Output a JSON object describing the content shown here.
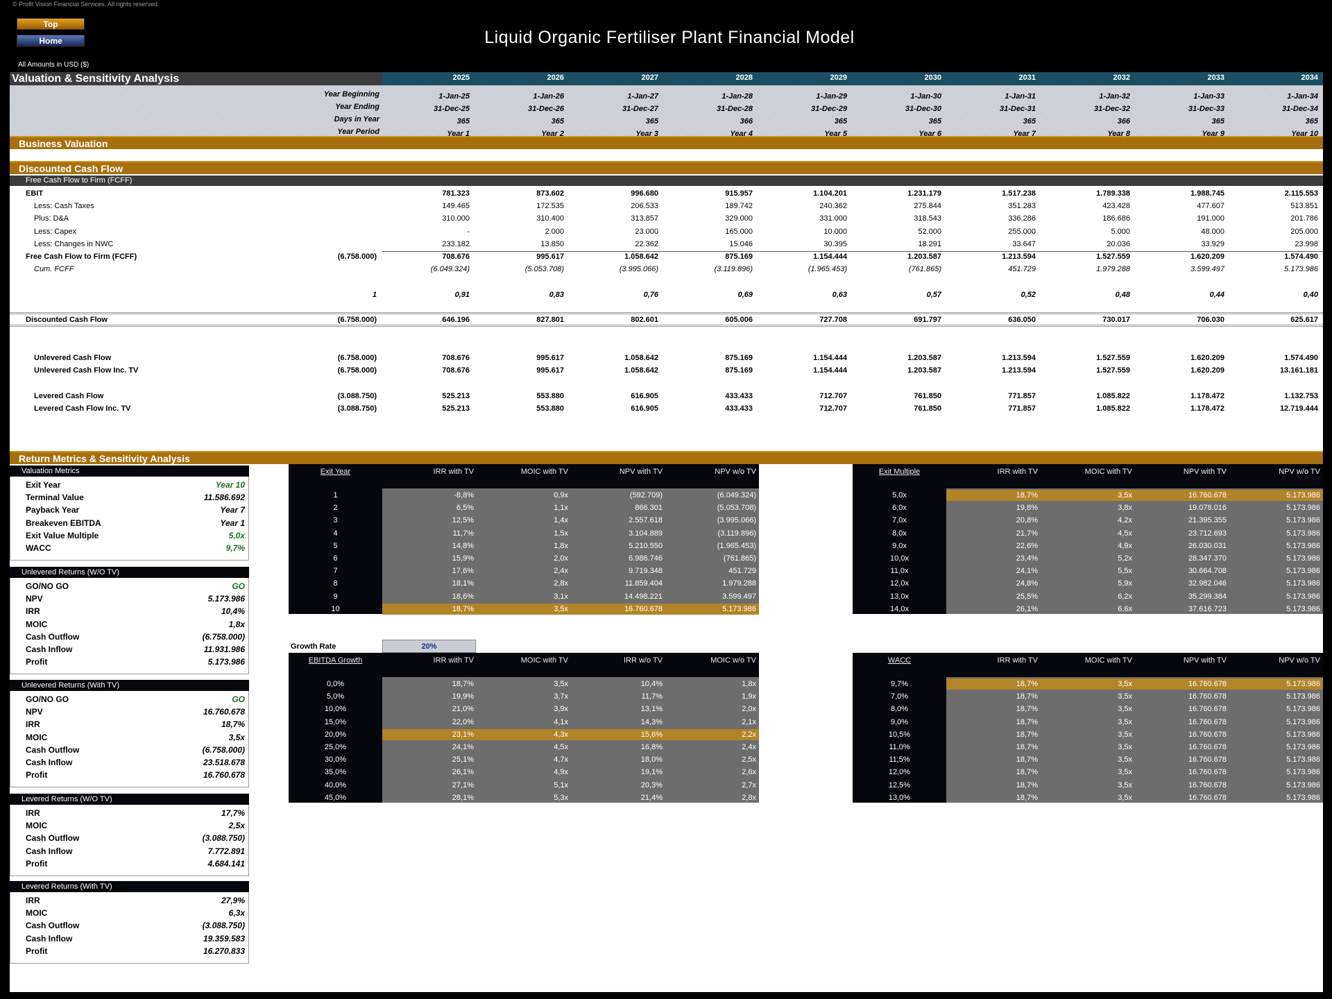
{
  "header": {
    "copyright": "© Profit Vision Financial Services. All rights reserved.",
    "top_button": "Top",
    "home_button": "Home",
    "title": "Liquid Organic Fertiliser Plant Financial Model",
    "currency_note": "All Amounts in  USD ($)"
  },
  "valuation": {
    "title": "Valuation & Sensitivity Analysis",
    "years": [
      "2025",
      "2026",
      "2027",
      "2028",
      "2029",
      "2030",
      "2031",
      "2032",
      "2033",
      "2034"
    ],
    "timeline": [
      {
        "label": "Year Beginning",
        "values": [
          "1-Jan-25",
          "1-Jan-26",
          "1-Jan-27",
          "1-Jan-28",
          "1-Jan-29",
          "1-Jan-30",
          "1-Jan-31",
          "1-Jan-32",
          "1-Jan-33",
          "1-Jan-34"
        ]
      },
      {
        "label": "Year Ending",
        "values": [
          "31-Dec-25",
          "31-Dec-26",
          "31-Dec-27",
          "31-Dec-28",
          "31-Dec-29",
          "31-Dec-30",
          "31-Dec-31",
          "31-Dec-32",
          "31-Dec-33",
          "31-Dec-34"
        ]
      },
      {
        "label": "Days in Year",
        "values": [
          "365",
          "365",
          "365",
          "366",
          "365",
          "365",
          "365",
          "366",
          "365",
          "365"
        ]
      },
      {
        "label": "Year Period",
        "values": [
          "Year 1",
          "Year 2",
          "Year 3",
          "Year 4",
          "Year 5",
          "Year 6",
          "Year 7",
          "Year 8",
          "Year 9",
          "Year 10"
        ]
      }
    ],
    "business_valuation": "Business Valuation",
    "dcf_title": "Discounted Cash Flow",
    "fcff_subheader": "Free Cash Flow to Firm (FCFF)",
    "rows": [
      {
        "label": "EBIT",
        "initial": "",
        "values": [
          "781.323",
          "873.602",
          "996.680",
          "915.957",
          "1.104.201",
          "1.231.179",
          "1.517.238",
          "1.789.338",
          "1.988.745",
          "2.115.553"
        ]
      },
      {
        "label": "Less: Cash Taxes",
        "initial": "",
        "values": [
          "149.465",
          "172.535",
          "206.533",
          "189.742",
          "240.362",
          "275.844",
          "351.283",
          "423.428",
          "477.607",
          "513.851"
        ]
      },
      {
        "label": "Plus: D&A",
        "initial": "",
        "values": [
          "310.000",
          "310.400",
          "313.857",
          "329.000",
          "331.000",
          "318.543",
          "336.286",
          "186.686",
          "191.000",
          "201.786"
        ]
      },
      {
        "label": "Less: Capex",
        "initial": "",
        "values": [
          "-",
          "2.000",
          "23.000",
          "165.000",
          "10.000",
          "52.000",
          "255.000",
          "5.000",
          "48.000",
          "205.000"
        ]
      },
      {
        "label": "Less: Changes in NWC",
        "initial": "",
        "values": [
          "233.182",
          "13.850",
          "22.362",
          "15.046",
          "30.395",
          "18.291",
          "33.647",
          "20.036",
          "33.929",
          "23.998"
        ]
      },
      {
        "label": "Free Cash Flow to Firm (FCFF)",
        "initial": "(6.758.000)",
        "values": [
          "708.676",
          "995.617",
          "1.058.642",
          "875.169",
          "1.154.444",
          "1.203.587",
          "1.213.594",
          "1.527.559",
          "1.620.209",
          "1.574.490"
        ]
      },
      {
        "label": "Cum. FCFF",
        "initial": "",
        "values": [
          "(6.049.324)",
          "(5.053.708)",
          "(3.995.066)",
          "(3.119.896)",
          "(1.965.453)",
          "(761.865)",
          "451.729",
          "1.979.288",
          "3.599.497",
          "5.173.986"
        ]
      },
      {
        "label": "",
        "initial": "1",
        "values": [
          "0,91",
          "0,83",
          "0,76",
          "0,69",
          "0,63",
          "0,57",
          "0,52",
          "0,48",
          "0,44",
          "0,40"
        ]
      },
      {
        "label": "Discounted Cash Flow",
        "initial": "(6.758.000)",
        "values": [
          "646.196",
          "827.801",
          "802.601",
          "605.006",
          "727.708",
          "691.797",
          "636.050",
          "730.017",
          "706.030",
          "625.617"
        ]
      },
      {
        "label": "Unlevered Cash Flow",
        "initial": "(6.758.000)",
        "values": [
          "708.676",
          "995.617",
          "1.058.642",
          "875.169",
          "1.154.444",
          "1.203.587",
          "1.213.594",
          "1.527.559",
          "1.620.209",
          "1.574.490"
        ]
      },
      {
        "label": "Unlevered Cash Flow Inc. TV",
        "initial": "(6.758.000)",
        "values": [
          "708.676",
          "995.617",
          "1.058.642",
          "875.169",
          "1.154.444",
          "1.203.587",
          "1.213.594",
          "1.527.559",
          "1.620.209",
          "13.161.181"
        ]
      },
      {
        "label": "Levered Cash Flow",
        "initial": "(3.088.750)",
        "values": [
          "525.213",
          "553.880",
          "616.905",
          "433.433",
          "712.707",
          "761.850",
          "771.857",
          "1.085.822",
          "1.178.472",
          "1.132.753"
        ]
      },
      {
        "label": "Levered Cash Flow Inc. TV",
        "initial": "(3.088.750)",
        "values": [
          "525.213",
          "553.880",
          "616.905",
          "433.433",
          "712.707",
          "761.850",
          "771.857",
          "1.085.822",
          "1.178.472",
          "12.719.444"
        ]
      }
    ]
  },
  "returns": {
    "title": "Return Metrics & Sensitivity Analysis",
    "panels": [
      {
        "title": "Valuation Metrics",
        "rows": [
          {
            "label": "Exit Year",
            "value": "Year 10"
          },
          {
            "label": "Terminal Value",
            "value": "11.586.692"
          },
          {
            "label": "Payback Year",
            "value": "Year 7"
          },
          {
            "label": "Breakeven EBITDA",
            "value": "Year 1"
          },
          {
            "label": "Exit Value Multiple",
            "value": "5,0x"
          },
          {
            "label": "WACC",
            "value": "9,7%"
          }
        ]
      },
      {
        "title": "Unlevered Returns (W/O TV)",
        "rows": [
          {
            "label": "GO/NO GO",
            "value": "GO"
          },
          {
            "label": "NPV",
            "value": "5.173.986"
          },
          {
            "label": "IRR",
            "value": "10,4%"
          },
          {
            "label": "MOIC",
            "value": "1,8x"
          },
          {
            "label": "Cash Outflow",
            "value": "(6.758.000)"
          },
          {
            "label": "Cash Inflow",
            "value": "11.931.986"
          },
          {
            "label": "Profit",
            "value": "5.173.986"
          }
        ]
      },
      {
        "title": "Unlevered Returns (With TV)",
        "rows": [
          {
            "label": "GO/NO GO",
            "value": "GO"
          },
          {
            "label": "NPV",
            "value": "16.760.678"
          },
          {
            "label": "IRR",
            "value": "18,7%"
          },
          {
            "label": "MOIC",
            "value": "3,5x"
          },
          {
            "label": "Cash Outflow",
            "value": "(6.758.000)"
          },
          {
            "label": "Cash Inflow",
            "value": "23.518.678"
          },
          {
            "label": "Profit",
            "value": "16.760.678"
          }
        ]
      },
      {
        "title": "Levered Returns (W/O TV)",
        "rows": [
          {
            "label": "IRR",
            "value": "17,7%"
          },
          {
            "label": "MOIC",
            "value": "2,5x"
          },
          {
            "label": "Cash Outflow",
            "value": "(3.088.750)"
          },
          {
            "label": "Cash Inflow",
            "value": "7.772.891"
          },
          {
            "label": "Profit",
            "value": "4.684.141"
          }
        ]
      },
      {
        "title": "Levered Returns (With TV)",
        "rows": [
          {
            "label": "IRR",
            "value": "27,9%"
          },
          {
            "label": "MOIC",
            "value": "6,3x"
          },
          {
            "label": "Cash Outflow",
            "value": "(3.088.750)"
          },
          {
            "label": "Cash Inflow",
            "value": "19.359.583"
          },
          {
            "label": "Profit",
            "value": "16.270.833"
          }
        ]
      }
    ],
    "growth_rate": {
      "label": "Growth Rate",
      "value": "20%"
    },
    "tables": [
      {
        "headers": [
          "Exit Year",
          "IRR with TV",
          "MOIC with TV",
          "NPV with TV",
          "NPV w/o TV"
        ],
        "highlight_row": 9,
        "rows": [
          [
            "1",
            "-8,8%",
            "0,9x",
            "(592.709)",
            "(6.049.324)"
          ],
          [
            "2",
            "6,5%",
            "1,1x",
            "866.301",
            "(5.053.708)"
          ],
          [
            "3",
            "12,5%",
            "1,4x",
            "2.557.618",
            "(3.995.066)"
          ],
          [
            "4",
            "11,7%",
            "1,5x",
            "3.104.889",
            "(3.119.896)"
          ],
          [
            "5",
            "14,8%",
            "1,8x",
            "5.210.550",
            "(1.965.453)"
          ],
          [
            "6",
            "15,9%",
            "2,0x",
            "6.986.746",
            "(761.865)"
          ],
          [
            "7",
            "17,6%",
            "2,4x",
            "9.719.348",
            "451.729"
          ],
          [
            "8",
            "18,1%",
            "2,8x",
            "11.859.404",
            "1.979.288"
          ],
          [
            "9",
            "18,6%",
            "3,1x",
            "14.498.221",
            "3.599.497"
          ],
          [
            "10",
            "18,7%",
            "3,5x",
            "16.760.678",
            "5.173.986"
          ]
        ]
      },
      {
        "headers": [
          "Exit Multiple",
          "IRR with TV",
          "MOIC with TV",
          "NPV with TV",
          "NPV w/o TV"
        ],
        "highlight_row": 0,
        "rows": [
          [
            "5,0x",
            "18,7%",
            "3,5x",
            "16.760.678",
            "5.173.986"
          ],
          [
            "6,0x",
            "19,8%",
            "3,8x",
            "19.078.016",
            "5.173.986"
          ],
          [
            "7,0x",
            "20,8%",
            "4,2x",
            "21.395.355",
            "5.173.986"
          ],
          [
            "8,0x",
            "21,7%",
            "4,5x",
            "23.712.693",
            "5.173.986"
          ],
          [
            "9,0x",
            "22,6%",
            "4,9x",
            "26.030.031",
            "5.173.986"
          ],
          [
            "10,0x",
            "23,4%",
            "5,2x",
            "28.347.370",
            "5.173.986"
          ],
          [
            "11,0x",
            "24,1%",
            "5,5x",
            "30.664.708",
            "5.173.986"
          ],
          [
            "12,0x",
            "24,8%",
            "5,9x",
            "32.982.046",
            "5.173.986"
          ],
          [
            "13,0x",
            "25,5%",
            "6,2x",
            "35.299.384",
            "5.173.986"
          ],
          [
            "14,0x",
            "26,1%",
            "6,6x",
            "37.616.723",
            "5.173.986"
          ]
        ]
      },
      {
        "headers": [
          "EBITDA Growth",
          "IRR with TV",
          "MOIC with TV",
          "IRR w/o TV",
          "MOIC w/o TV"
        ],
        "highlight_row": 4,
        "rows": [
          [
            "0,0%",
            "18,7%",
            "3,5x",
            "10,4%",
            "1,8x"
          ],
          [
            "5,0%",
            "19,9%",
            "3,7x",
            "11,7%",
            "1,9x"
          ],
          [
            "10,0%",
            "21,0%",
            "3,9x",
            "13,1%",
            "2,0x"
          ],
          [
            "15,0%",
            "22,0%",
            "4,1x",
            "14,3%",
            "2,1x"
          ],
          [
            "20,0%",
            "23,1%",
            "4,3x",
            "15,6%",
            "2,2x"
          ],
          [
            "25,0%",
            "24,1%",
            "4,5x",
            "16,8%",
            "2,4x"
          ],
          [
            "30,0%",
            "25,1%",
            "4,7x",
            "18,0%",
            "2,5x"
          ],
          [
            "35,0%",
            "26,1%",
            "4,9x",
            "19,1%",
            "2,6x"
          ],
          [
            "40,0%",
            "27,1%",
            "5,1x",
            "20,3%",
            "2,7x"
          ],
          [
            "45,0%",
            "28,1%",
            "5,3x",
            "21,4%",
            "2,8x"
          ]
        ]
      },
      {
        "headers": [
          "WACC",
          "IRR with TV",
          "MOIC with TV",
          "NPV with TV",
          "NPV w/o TV"
        ],
        "highlight_row": 0,
        "rows": [
          [
            "9,7%",
            "18,7%",
            "3,5x",
            "16.760.678",
            "5.173.986"
          ],
          [
            "7,0%",
            "18,7%",
            "3,5x",
            "16.760.678",
            "5.173.986"
          ],
          [
            "8,0%",
            "18,7%",
            "3,5x",
            "16.760.678",
            "5.173.986"
          ],
          [
            "9,0%",
            "18,7%",
            "3,5x",
            "16.760.678",
            "5.173.986"
          ],
          [
            "10,5%",
            "18,7%",
            "3,5x",
            "16.760.678",
            "5.173.986"
          ],
          [
            "11,0%",
            "18,7%",
            "3,5x",
            "16.760.678",
            "5.173.986"
          ],
          [
            "11,5%",
            "18,7%",
            "3,5x",
            "16.760.678",
            "5.173.986"
          ],
          [
            "12,0%",
            "18,7%",
            "3,5x",
            "16.760.678",
            "5.173.986"
          ],
          [
            "12,5%",
            "18,7%",
            "3,5x",
            "16.760.678",
            "5.173.986"
          ],
          [
            "13,0%",
            "18,7%",
            "3,5x",
            "16.760.678",
            "5.173.986"
          ]
        ]
      }
    ]
  },
  "colors": {
    "gold_bar": "#a86f0f",
    "teal_header": "#1c4f63",
    "highlight": "#b28428",
    "grid_gray": "#6d6d6d",
    "go_green": "#1a6b2c"
  }
}
